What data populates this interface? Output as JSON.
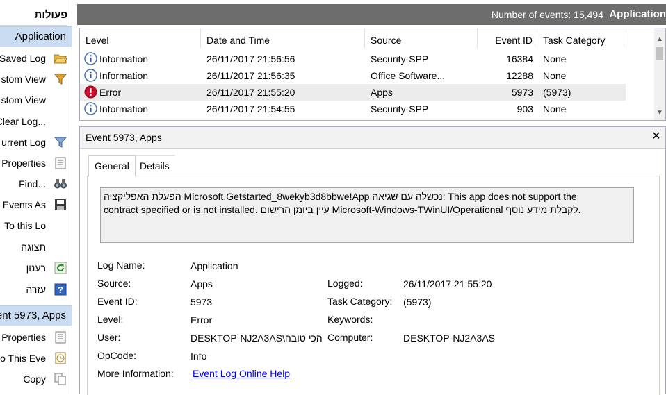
{
  "actions": {
    "title": "פעולות",
    "section_application": "Application",
    "items": [
      {
        "label": "Saved Log",
        "icon": "folder-open-icon"
      },
      {
        "label": "stom View",
        "icon": "filter-icon"
      },
      {
        "label": "stom View",
        "icon": ""
      },
      {
        "label": "Clear Log...",
        "icon": ""
      },
      {
        "label": "urrent Log",
        "icon": "filter-icon"
      },
      {
        "label": "Properties",
        "icon": "properties-icon"
      },
      {
        "label": "Find...",
        "icon": "binoculars-icon"
      },
      {
        "label": "Events As",
        "icon": "save-icon"
      },
      {
        "label": "To this Lo",
        "icon": ""
      },
      {
        "label": "תצוגה",
        "icon": ""
      },
      {
        "label": "רענון",
        "icon": "refresh-icon"
      },
      {
        "label": "עזרה",
        "icon": "help-icon"
      }
    ],
    "section_event": "Event 5973, Apps",
    "event_items": [
      {
        "label": "Properties",
        "icon": "properties-icon"
      },
      {
        "label": "o This Eve",
        "icon": "task-icon"
      },
      {
        "label": "Copy",
        "icon": "copy-icon"
      }
    ]
  },
  "topbar": {
    "count": "Number of events: 15,494",
    "name": "Application"
  },
  "grid": {
    "columns": [
      "Level",
      "Date and Time",
      "Source",
      "Event ID",
      "Task Category"
    ],
    "rows": [
      {
        "level": "Information",
        "date": "26/11/2017 21:56:56",
        "source": "Security-SPP",
        "id": "16384",
        "task": "None",
        "kind": "info"
      },
      {
        "level": "Information",
        "date": "26/11/2017 21:56:35",
        "source": "Office Software...",
        "id": "12288",
        "task": "None",
        "kind": "info"
      },
      {
        "level": "Error",
        "date": "26/11/2017 21:55:20",
        "source": "Apps",
        "id": "5973",
        "task": "(5973)",
        "kind": "error"
      },
      {
        "level": "Information",
        "date": "26/11/2017 21:54:55",
        "source": "Security-SPP",
        "id": "903",
        "task": "None",
        "kind": "info"
      }
    ]
  },
  "detail": {
    "title": "Event 5973, Apps",
    "tabs": [
      "General",
      "Details"
    ],
    "message_line1": "הפעלת האפליקציה Microsoft.Getstarted_8wekyb3d8bbwe!App נכשלה עם שגיאה: This app does not support the",
    "message_line2": "contract specified or is not installed. עיין ביומן הרישום Microsoft-Windows-TWinUI/Operational לקבלת מידע נוסף.",
    "fields": {
      "log_name_label": "Log Name:",
      "log_name": "Application",
      "source_label": "Source:",
      "source": "Apps",
      "logged_label": "Logged:",
      "logged": "26/11/2017 21:55:20",
      "event_id_label": "Event ID:",
      "event_id": "5973",
      "task_label": "Task Category:",
      "task": "(5973)",
      "level_label": "Level:",
      "level": "Error",
      "keywords_label": "Keywords:",
      "user_label": "User:",
      "user": "DESKTOP-NJ2A3AS\\הכי טובה",
      "computer_label": "Computer:",
      "computer": "DESKTOP-NJ2A3AS",
      "opcode_label": "OpCode:",
      "opcode": "Info",
      "more_label": "More Information:",
      "more_link": "Event Log Online Help"
    }
  },
  "colors": {
    "section_bg": "#c9dcf1",
    "topbar_bg": "#6d6d6d",
    "info_icon": "#3b6fb6",
    "error_icon": "#c8102e"
  }
}
